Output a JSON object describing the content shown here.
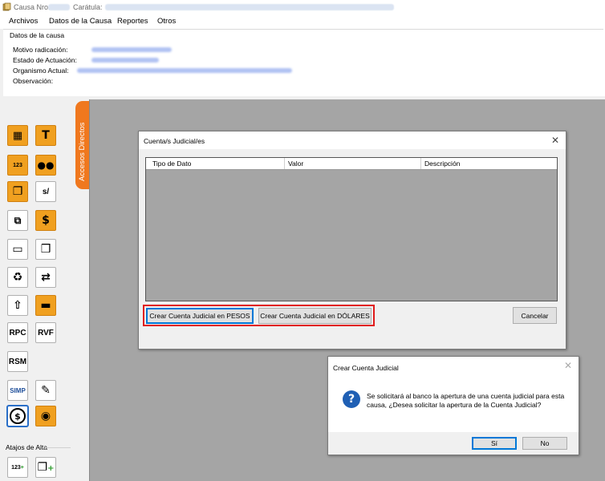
{
  "titlebar": {
    "causa_label": "Causa Nro.:",
    "caratula_label": "Carátula:"
  },
  "menu": [
    "Archivos",
    "Datos de la Causa",
    "Reportes",
    "Otros"
  ],
  "datos": {
    "legend": "Datos de la causa",
    "rows": [
      "Motivo radicación:",
      "Estado de Actuación:",
      "Organismo Actual:",
      "Observación:"
    ]
  },
  "sidebar": {
    "tab_label": "Accesos Directos",
    "icons": [
      {
        "name": "calculator-icon",
        "glyph": "▦"
      },
      {
        "name": "text-icon",
        "glyph": "T"
      },
      {
        "name": "numbers-icon",
        "glyph": "123"
      },
      {
        "name": "people-icon",
        "glyph": "👥"
      },
      {
        "name": "copy-stack-icon",
        "glyph": "❐"
      },
      {
        "name": "sheet-slash-icon",
        "glyph": "s/"
      },
      {
        "name": "resize-icon",
        "glyph": "⧉"
      },
      {
        "name": "dollar-document-icon",
        "glyph": "$"
      },
      {
        "name": "folder-icon",
        "glyph": "▭"
      },
      {
        "name": "documents-icon",
        "glyph": "❒"
      },
      {
        "name": "recycle-icon",
        "glyph": "♻"
      },
      {
        "name": "transfer-icon",
        "glyph": "⇄"
      },
      {
        "name": "upload-document-icon",
        "glyph": "⇧"
      },
      {
        "name": "monitor-icon",
        "glyph": "▬"
      },
      {
        "name": "rpc-icon",
        "glyph": "RPC"
      },
      {
        "name": "rvf-icon",
        "glyph": "RVF"
      },
      {
        "name": "rsm-icon",
        "glyph": "RSM"
      },
      {
        "name": "simp-icon",
        "glyph": "SIMP"
      },
      {
        "name": "edit-document-icon",
        "glyph": "✎"
      },
      {
        "name": "dollar-circle-icon",
        "glyph": "$"
      },
      {
        "name": "eye-icon",
        "glyph": "◉"
      }
    ],
    "atajos_label": "Atajos de Alta"
  },
  "dialog_cuentas": {
    "title": "Cuenta/s Judicial/es",
    "columns": [
      "Tipo de Dato",
      "Valor",
      "Descripción"
    ],
    "btn_pesos": "Crear Cuenta Judicial en PESOS",
    "btn_dolares": "Crear Cuenta Judicial en DÓLARES",
    "btn_cancelar": "Cancelar"
  },
  "dialog_confirm": {
    "title": "Crear Cuenta Judicial",
    "message": "Se solicitará al banco la apertura de una cuenta judicial para esta causa, ¿Desea solicitar la apertura de la Cuenta Judicial?",
    "btn_si": "Sí",
    "btn_no": "No"
  },
  "colors": {
    "accent_orange": "#f0781e",
    "highlight_red": "#e01a1a",
    "workspace_gray": "#a5a5a5",
    "focus_blue": "#0078d7"
  }
}
